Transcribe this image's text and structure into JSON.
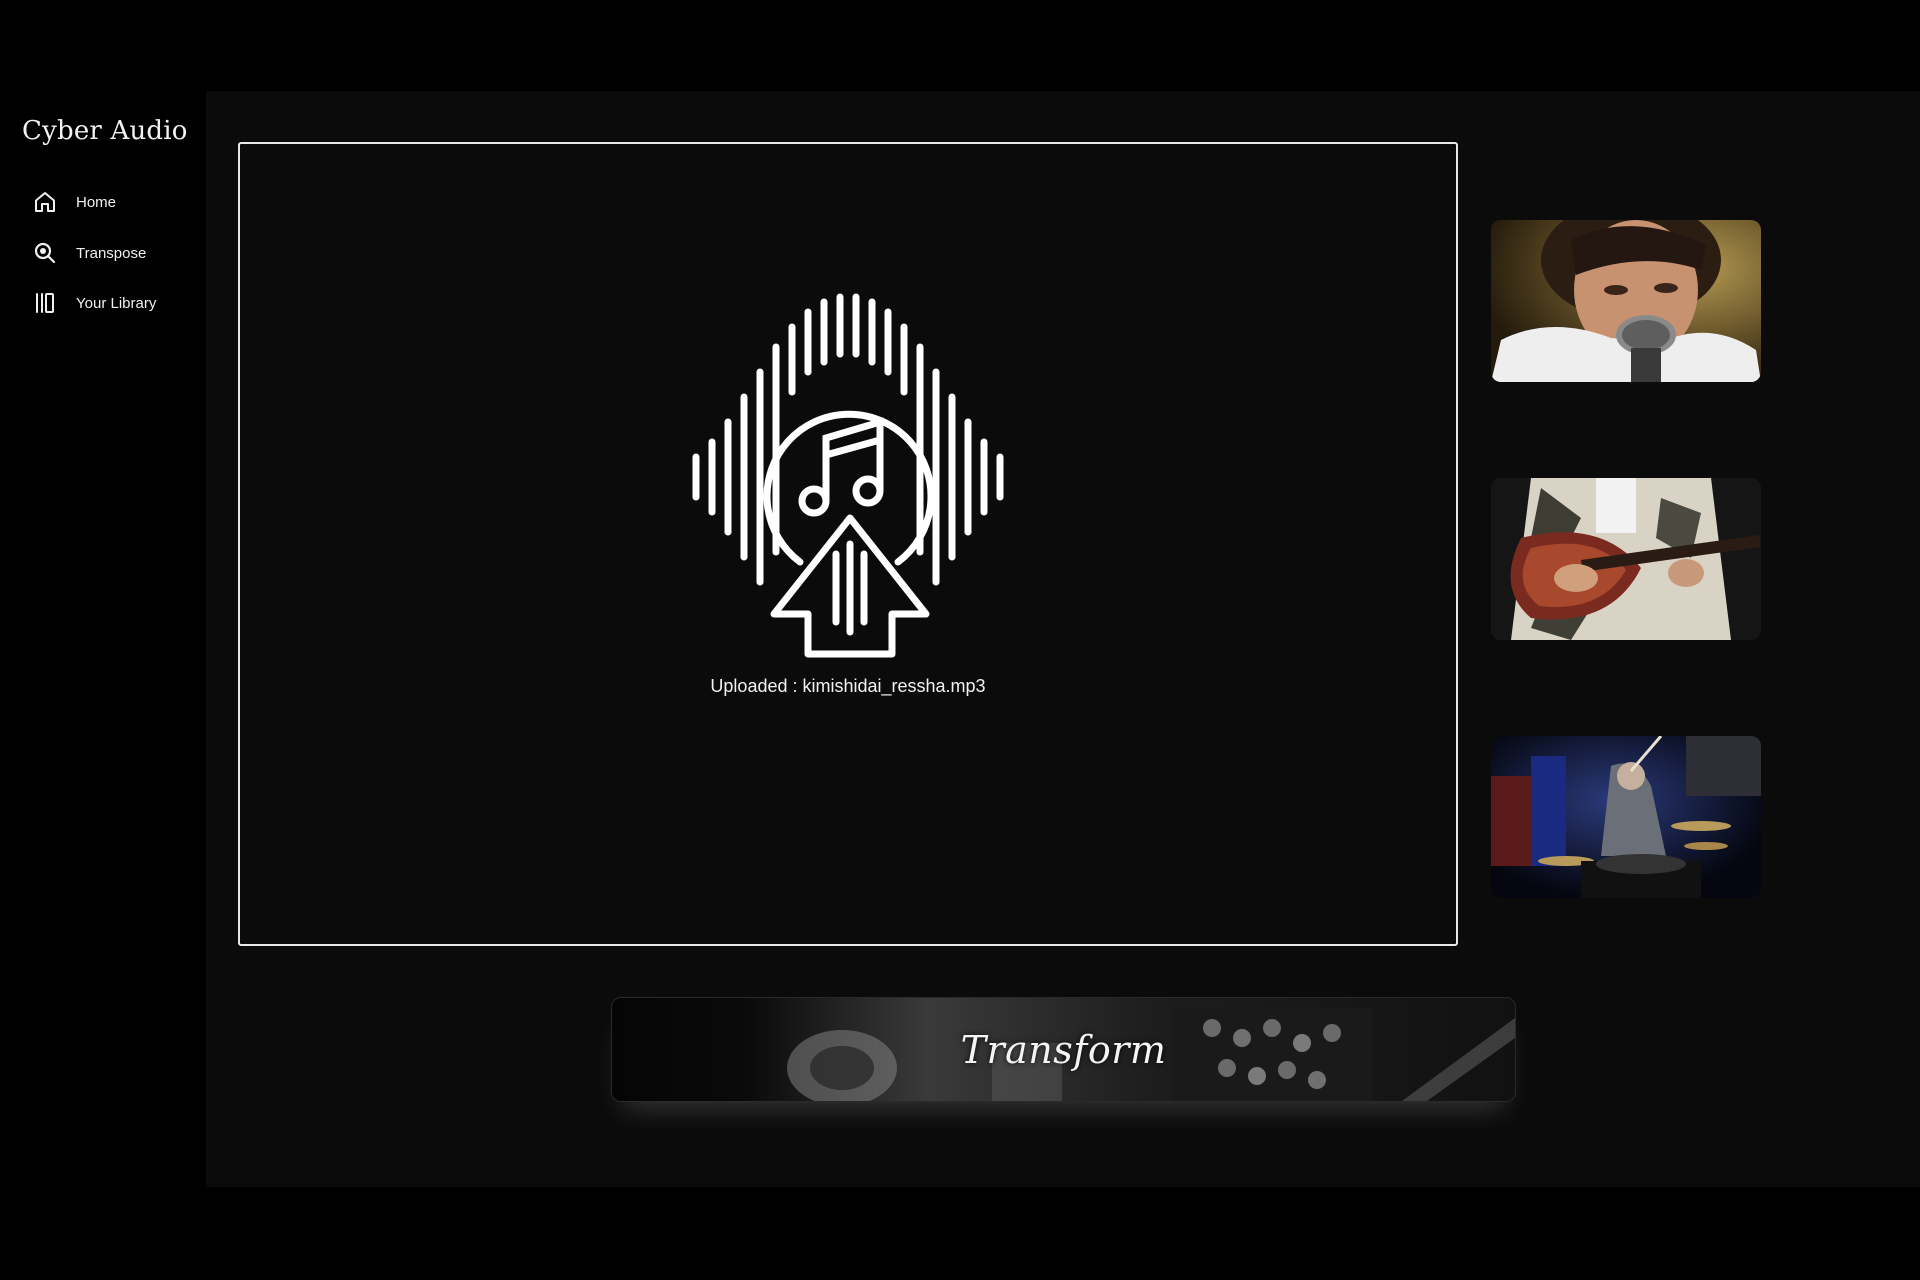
{
  "app": {
    "brand": "Cyber Audio"
  },
  "sidebar": {
    "items": [
      {
        "label": "Home",
        "icon": "home-icon"
      },
      {
        "label": "Transpose",
        "icon": "search-icon"
      },
      {
        "label": "Your Library",
        "icon": "library-icon"
      }
    ]
  },
  "upload": {
    "icon": "music-upload-icon",
    "status_text": "Uploaded : kimishidai_ressha.mp3"
  },
  "gallery": {
    "images": [
      {
        "subject": "singer-with-microphone"
      },
      {
        "subject": "guitarist-playing-electric-guitar"
      },
      {
        "subject": "drummer-on-stage"
      }
    ]
  },
  "actions": {
    "transform_label": "Transform"
  },
  "colors": {
    "background": "#000000",
    "panel": "#0b0b0b",
    "border": "#e8e8e8",
    "text": "#f2f2f2"
  }
}
